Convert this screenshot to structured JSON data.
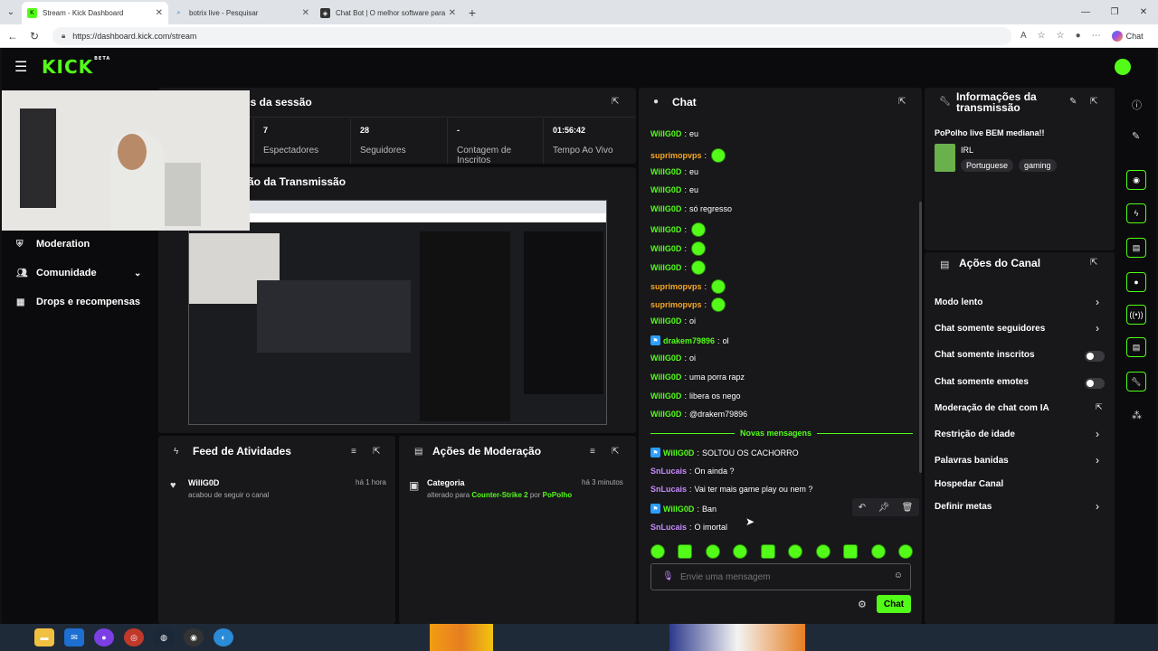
{
  "browser": {
    "tabs": [
      {
        "title": "Stream - Kick Dashboard",
        "active": true
      },
      {
        "title": "botrix live - Pesquisar",
        "active": false
      },
      {
        "title": "Chat Bot | O melhor software para",
        "active": false
      }
    ],
    "url": "https://dashboard.kick.com/stream",
    "copilot_label": "Chat"
  },
  "app": {
    "logo": "KICK",
    "logo_tag": "BETA",
    "accent": "#53fc18"
  },
  "sidebar": {
    "items": [
      {
        "label": "Moderation",
        "icon": "shield-icon"
      },
      {
        "label": "Comunidade",
        "icon": "users-icon"
      },
      {
        "label": "Drops e recompensas",
        "icon": "gift-icon"
      }
    ]
  },
  "session": {
    "title": "es da sessão",
    "stats": [
      {
        "value": "7",
        "label": "Espectadores"
      },
      {
        "value": "28",
        "label": "Seguidores"
      },
      {
        "value": "-",
        "label": "Contagem de Inscritos"
      },
      {
        "value": "01:56:42",
        "label": "Tempo Ao Vivo"
      }
    ]
  },
  "preview": {
    "title": "ão da Transmissão"
  },
  "activity": {
    "title": "Feed de Atividades",
    "item_user": "WillG0D",
    "item_text": "acabou de seguir o canal",
    "item_time": "há 1 hora"
  },
  "modactions": {
    "title": "Ações de Moderação",
    "item_title": "Categoria",
    "item_prefix": "alterado para",
    "item_game": "Counter-Strike 2",
    "item_by": "por",
    "item_user": "PoPolho",
    "item_time": "há 3 minutos"
  },
  "chat": {
    "title": "Chat",
    "messages": [
      {
        "user": "WillG0D",
        "color": "green",
        "text": "eu"
      },
      {
        "user": "suprimopvps",
        "color": "orange",
        "text": "",
        "emote": true
      },
      {
        "user": "WillG0D",
        "color": "green",
        "text": "eu"
      },
      {
        "user": "WillG0D",
        "color": "green",
        "text": "eu"
      },
      {
        "user": "WillG0D",
        "color": "green",
        "text": "só regresso"
      },
      {
        "user": "WillG0D",
        "color": "green",
        "text": "",
        "emote": true
      },
      {
        "user": "WillG0D",
        "color": "green",
        "text": "",
        "emote": true
      },
      {
        "user": "WillG0D",
        "color": "green",
        "text": "",
        "emote": true
      },
      {
        "user": "suprimopvps",
        "color": "orange",
        "text": "",
        "emote": true
      },
      {
        "user": "suprimopvps",
        "color": "orange",
        "text": "",
        "emote": true
      },
      {
        "user": "WillG0D",
        "color": "green",
        "text": "oi"
      },
      {
        "user": "drakem79896",
        "color": "green",
        "text": "ol",
        "badge": true
      },
      {
        "user": "WillG0D",
        "color": "green",
        "text": "oi"
      },
      {
        "user": "WillG0D",
        "color": "green",
        "text": "uma porra rapz"
      },
      {
        "user": "WillG0D",
        "color": "green",
        "text": "libera os nego"
      },
      {
        "user": "WillG0D",
        "color": "green",
        "text": "@drakem79896"
      }
    ],
    "divider": "Novas mensagens",
    "new_messages": [
      {
        "user": "WillG0D",
        "color": "green",
        "text": "SOLTOU OS CACHORRO",
        "badge": true
      },
      {
        "user": "SnLucais",
        "color": "purple",
        "text": "On ainda ?"
      },
      {
        "user": "SnLucais",
        "color": "purple",
        "text": "Vai ter mais game play ou nem ?"
      },
      {
        "user": "WillG0D",
        "color": "green",
        "text": "Ban",
        "badge": true
      },
      {
        "user": "SnLucais",
        "color": "purple",
        "text": "O imortal"
      }
    ],
    "placeholder": "Envie uma mensagem",
    "send_label": "Chat"
  },
  "info": {
    "title": "Informações da transmissão",
    "stream_title": "PoPolho live BEM mediana!!",
    "category": "IRL",
    "tags": [
      "Portuguese",
      "gaming"
    ]
  },
  "channel": {
    "title": "Ações do Canal",
    "rows": [
      {
        "label": "Modo lento",
        "control": "arrow"
      },
      {
        "label": "Chat somente seguidores",
        "control": "arrow"
      },
      {
        "label": "Chat somente inscritos",
        "control": "toggle"
      },
      {
        "label": "Chat somente emotes",
        "control": "toggle"
      },
      {
        "label": "Moderação de chat com IA",
        "control": "external"
      },
      {
        "label": "Restrição de idade",
        "control": "arrow"
      },
      {
        "label": "Palavras banidas",
        "control": "arrow"
      },
      {
        "label": "Hospedar Canal",
        "control": "none"
      },
      {
        "label": "Definir metas",
        "control": "arrow"
      }
    ]
  }
}
